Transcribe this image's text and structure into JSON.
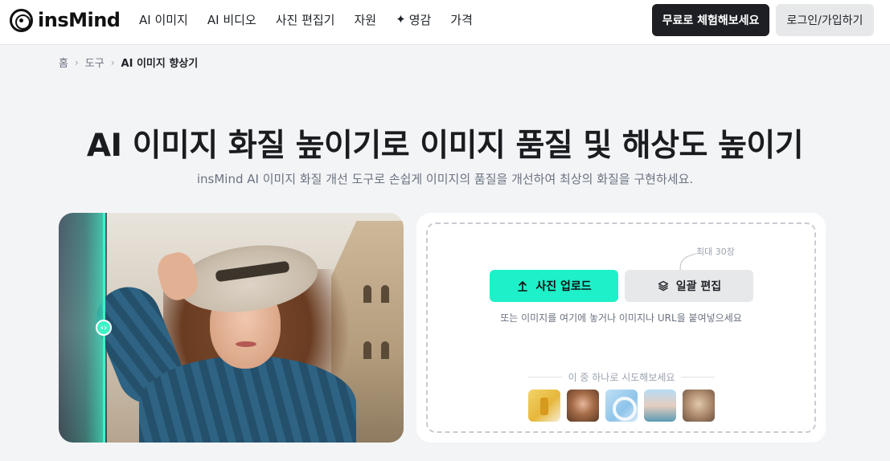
{
  "header": {
    "logo_text": "insMind",
    "nav": [
      {
        "label": "AI 이미지"
      },
      {
        "label": "AI 비디오"
      },
      {
        "label": "사진 편집기"
      },
      {
        "label": "자원"
      },
      {
        "label": "영감",
        "icon": "sparkle-icon"
      },
      {
        "label": "가격"
      }
    ],
    "cta_label": "무료로 체험해보세요",
    "login_label": "로그인/가입하기"
  },
  "breadcrumb": {
    "items": [
      "홈",
      "도구"
    ],
    "current": "AI 이미지 향상기"
  },
  "hero": {
    "title": "AI 이미지 화질 높이기로 이미지 품질 및 해상도 높이기",
    "subtitle": "insMind AI 이미지 화질 개선 도구로 손쉽게 이미지의 품질을 개선하여 최상의 화질을 구현하세요."
  },
  "upload": {
    "max_note": "최대 30장",
    "upload_label": "사진 업로드",
    "batch_label": "일괄 편집",
    "drop_hint": "또는 이미지를 여기에 놓거나 이미지나 URL을 붙여넣으세요",
    "try_label": "이 중 하나로 시도해보세요",
    "samples": [
      "product-bottle",
      "portrait-woman",
      "headphones",
      "landscape-coast",
      "vintage-portrait"
    ]
  },
  "colors": {
    "accent": "#1ef0c9",
    "cta_bg": "#1d1f24",
    "page_bg": "#f3f4f6"
  }
}
